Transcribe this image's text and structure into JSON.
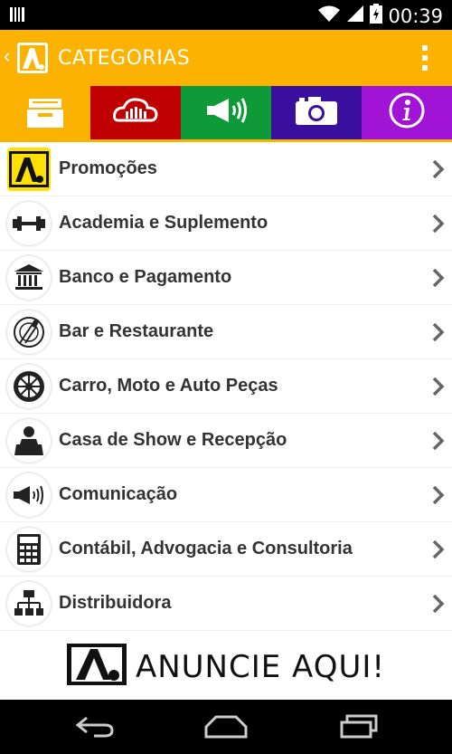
{
  "status": {
    "time": "00:39"
  },
  "header": {
    "title": "CATEGORIAS"
  },
  "tabs": [
    {
      "name": "categorias",
      "color": "#fbb200",
      "icon": "archive-box-icon"
    },
    {
      "name": "eventos",
      "color": "#c00000",
      "icon": "crowd-icon"
    },
    {
      "name": "anuncios",
      "color": "#0f9a3a",
      "icon": "megaphone-icon"
    },
    {
      "name": "fotos",
      "color": "#3a0f9e",
      "icon": "camera-icon"
    },
    {
      "name": "info",
      "color": "#a114d6",
      "icon": "info-icon"
    }
  ],
  "categories": [
    {
      "label": "Promoções",
      "icon": "brand-logo-icon"
    },
    {
      "label": "Academia e Suplemento",
      "icon": "dumbbell-icon"
    },
    {
      "label": "Banco e Pagamento",
      "icon": "bank-icon"
    },
    {
      "label": "Bar e Restaurante",
      "icon": "plate-cutlery-icon"
    },
    {
      "label": "Carro, Moto e Auto Peças",
      "icon": "wheel-icon"
    },
    {
      "label": "Casa de Show e Recepção",
      "icon": "performer-icon"
    },
    {
      "label": "Comunicação",
      "icon": "megaphone-icon"
    },
    {
      "label": "Contábil, Advogacia e Consultoria",
      "icon": "calculator-icon"
    },
    {
      "label": "Distribuidora",
      "icon": "org-chart-icon"
    }
  ],
  "banner": {
    "text": "ANUNCIE AQUI!"
  },
  "colors": {
    "accent": "#fbb200"
  }
}
